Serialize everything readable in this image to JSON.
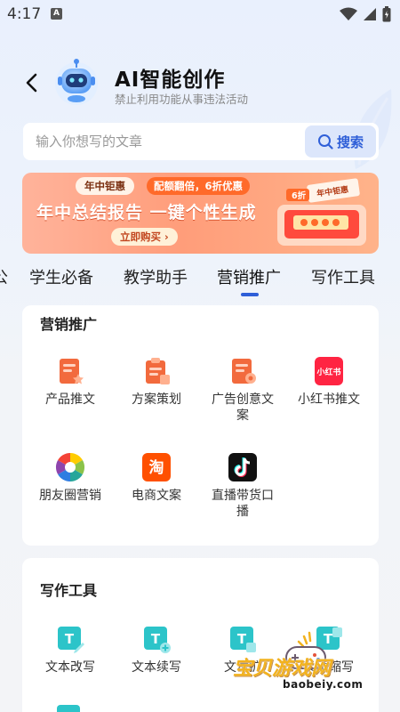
{
  "status_bar": {
    "time": "4:17",
    "notif_badge": "A"
  },
  "header": {
    "title": "AI智能创作",
    "subtitle": "禁止利用功能从事违法活动"
  },
  "search": {
    "placeholder": "输入你想写的文章",
    "button_label": "搜索"
  },
  "banner": {
    "tag_1": "年中钜惠",
    "tag_2": "配额翻倍，6折优惠",
    "headline": "年中总结报告 一键个性生成",
    "cta": "立即购买",
    "badge": "6折",
    "ticket_label": "年中钜惠"
  },
  "tabs": {
    "items": [
      {
        "label": "公"
      },
      {
        "label": "学生必备"
      },
      {
        "label": "教学助手"
      },
      {
        "label": "营销推广"
      },
      {
        "label": "写作工具"
      }
    ],
    "active_index": 3
  },
  "marketing": {
    "title": "营销推广",
    "items": [
      {
        "label": "产品推文",
        "icon": "product-doc-icon"
      },
      {
        "label": "方案策划",
        "icon": "plan-doc-icon"
      },
      {
        "label": "广告创意文案",
        "icon": "ad-doc-icon"
      },
      {
        "label": "小红书推文",
        "icon": "xiaohongshu-icon",
        "icon_text": "小红书"
      },
      {
        "label": "朋友圈营销",
        "icon": "moments-aperture-icon"
      },
      {
        "label": "电商文案",
        "icon": "taobao-icon",
        "icon_text": "淘"
      },
      {
        "label": "直播带货口播",
        "icon": "tiktok-icon"
      }
    ]
  },
  "writing": {
    "title": "写作工具",
    "items": [
      {
        "label": "文本改写",
        "icon": "text-edit-icon"
      },
      {
        "label": "文本续写",
        "icon": "text-continue-icon"
      },
      {
        "label": "文本扩",
        "icon": "text-expand-icon"
      },
      {
        "label": "文本缩写",
        "icon": "text-shrink-icon"
      }
    ]
  },
  "watermark": {
    "text": "宝贝游戏网",
    "url": "baobeiy.com"
  },
  "colors": {
    "accent": "#2f5fd8",
    "orange": "#f26a3d",
    "teal": "#2cc4c9",
    "banner": "#ff9d7a"
  }
}
